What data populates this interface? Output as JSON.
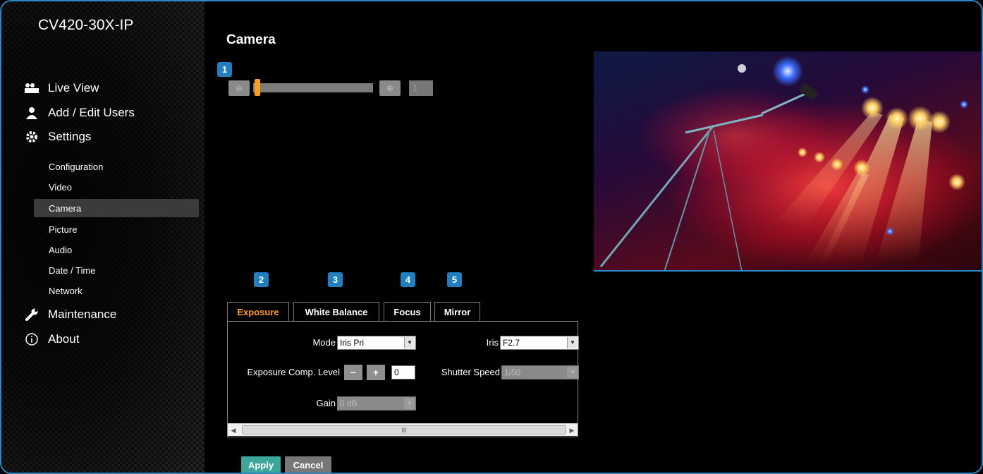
{
  "app": {
    "model": "CV420-30X-IP"
  },
  "sidebar": {
    "main_items": [
      {
        "label": "Live View",
        "icon": "video-camera-icon"
      },
      {
        "label": "Add / Edit Users",
        "icon": "user-icon"
      },
      {
        "label": "Settings",
        "icon": "gear-icon"
      },
      {
        "label": "Maintenance",
        "icon": "wrench-icon"
      },
      {
        "label": "About",
        "icon": "info-icon"
      }
    ],
    "settings_items": [
      "Configuration",
      "Video",
      "Camera",
      "Picture",
      "Audio",
      "Date / Time",
      "Network"
    ],
    "active_item": "Camera"
  },
  "page": {
    "title": "Camera"
  },
  "callouts": [
    "1",
    "2",
    "3",
    "4",
    "5"
  ],
  "zoom": {
    "value": "1",
    "position": 0.0
  },
  "tabs": [
    {
      "label": "Exposure",
      "active": true
    },
    {
      "label": "White Balance",
      "active": false
    },
    {
      "label": "Focus",
      "active": false
    },
    {
      "label": "Mirror",
      "active": false
    }
  ],
  "exposure": {
    "mode_label": "Mode",
    "mode_value": "Iris Pri",
    "iris_label": "Iris",
    "iris_value": "F2.7",
    "comp_label": "Exposure Comp. Level",
    "comp_minus": "−",
    "comp_plus": "+",
    "comp_value": "0",
    "shutter_label": "Shutter Speed",
    "shutter_value": "1/50",
    "gain_label": "Gain",
    "gain_value": "0 dB"
  },
  "scrollbar": {
    "grip": "III"
  },
  "buttons": {
    "apply": "Apply",
    "cancel": "Cancel"
  },
  "colors": {
    "accent": "#2a86c6",
    "active_tab": "#ff9d1a",
    "apply": "#3aa79a"
  }
}
